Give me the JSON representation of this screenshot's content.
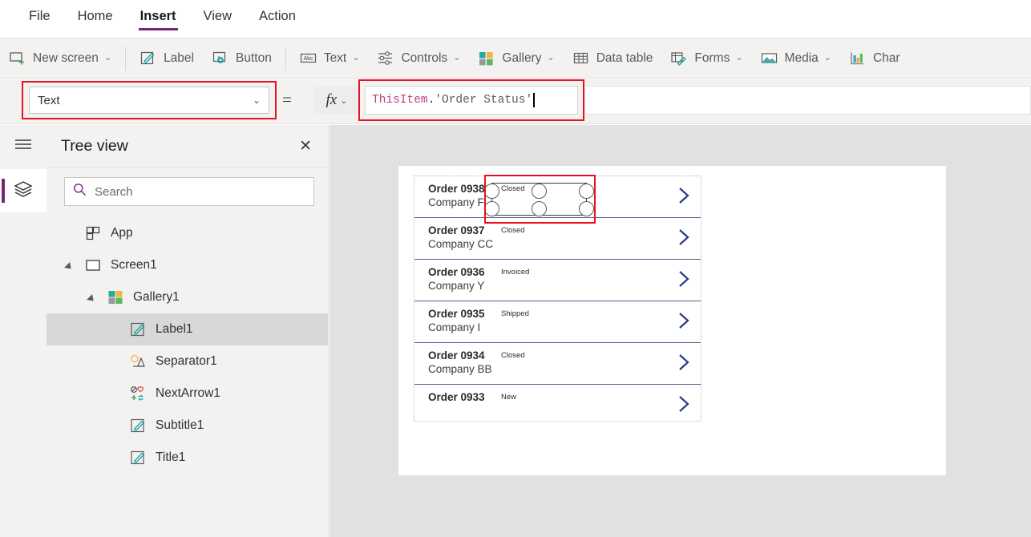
{
  "menu": {
    "items": [
      {
        "label": "File",
        "active": false
      },
      {
        "label": "Home",
        "active": false
      },
      {
        "label": "Insert",
        "active": true
      },
      {
        "label": "View",
        "active": false
      },
      {
        "label": "Action",
        "active": false
      }
    ]
  },
  "ribbon": {
    "items": [
      {
        "label": "New screen",
        "icon": "new-screen-icon",
        "caret": "⌄"
      },
      {
        "label": "Label",
        "icon": "label-icon",
        "caret": ""
      },
      {
        "label": "Button",
        "icon": "button-icon",
        "caret": ""
      },
      {
        "label": "Text",
        "icon": "text-abc-icon",
        "caret": "⌄"
      },
      {
        "label": "Controls",
        "icon": "controls-sliders-icon",
        "caret": "⌄"
      },
      {
        "label": "Gallery",
        "icon": "gallery-icon",
        "caret": "⌄"
      },
      {
        "label": "Data table",
        "icon": "data-table-icon",
        "caret": ""
      },
      {
        "label": "Forms",
        "icon": "forms-icon",
        "caret": "⌄"
      },
      {
        "label": "Media",
        "icon": "media-image-icon",
        "caret": "⌄"
      },
      {
        "label": "Char",
        "icon": "charts-bar-icon",
        "caret": ""
      }
    ]
  },
  "formula_bar": {
    "property_value": "Text",
    "property_caret": "⌄",
    "equals": "=",
    "fx_label": "fx",
    "fx_caret": "⌄",
    "formula": {
      "global": "ThisItem",
      "dot": ".",
      "string": "'Order Status'"
    },
    "highlight_color": "#e81123"
  },
  "left_rail": {
    "hamburger_icon": "hamburger-menu-icon",
    "tree_view_icon": "layers-icon",
    "active_color": "#742774"
  },
  "tree_view": {
    "title": "Tree view",
    "close_label": "✕",
    "search": {
      "placeholder": "Search",
      "value": "Search",
      "icon": "search-icon"
    },
    "nodes": [
      {
        "label": "App",
        "icon": "app-icon",
        "depth": 0,
        "twisty": false,
        "selected": false
      },
      {
        "label": "Screen1",
        "icon": "screen-icon",
        "depth": 0,
        "twisty": true,
        "selected": false
      },
      {
        "label": "Gallery1",
        "icon": "gallery-icon",
        "depth": 1,
        "twisty": true,
        "selected": false
      },
      {
        "label": "Label1",
        "icon": "label-icon",
        "depth": 2,
        "twisty": false,
        "selected": true
      },
      {
        "label": "Separator1",
        "icon": "separator-icon",
        "depth": 2,
        "twisty": false,
        "selected": false
      },
      {
        "label": "NextArrow1",
        "icon": "icon-shapes-icon",
        "depth": 2,
        "twisty": false,
        "selected": false
      },
      {
        "label": "Subtitle1",
        "icon": "label-icon",
        "depth": 2,
        "twisty": false,
        "selected": false
      },
      {
        "label": "Title1",
        "icon": "label-icon",
        "depth": 2,
        "twisty": false,
        "selected": false
      }
    ]
  },
  "canvas": {
    "gallery": {
      "rows": [
        {
          "title": "Order 0938",
          "subtitle": "Company F",
          "status": "Closed"
        },
        {
          "title": "Order 0937",
          "subtitle": "Company CC",
          "status": "Closed"
        },
        {
          "title": "Order 0936",
          "subtitle": "Company Y",
          "status": "Invoiced"
        },
        {
          "title": "Order 0935",
          "subtitle": "Company I",
          "status": "Shipped"
        },
        {
          "title": "Order 0934",
          "subtitle": "Company BB",
          "status": "Closed"
        },
        {
          "title": "Order 0933",
          "subtitle": "",
          "status": "New"
        }
      ],
      "chevron_color": "#2a3a8c",
      "divider_color": "#5c5c8a"
    },
    "selection": {
      "selected_control": "Label1",
      "handle_count": 6,
      "highlight_color": "#e81123"
    }
  }
}
